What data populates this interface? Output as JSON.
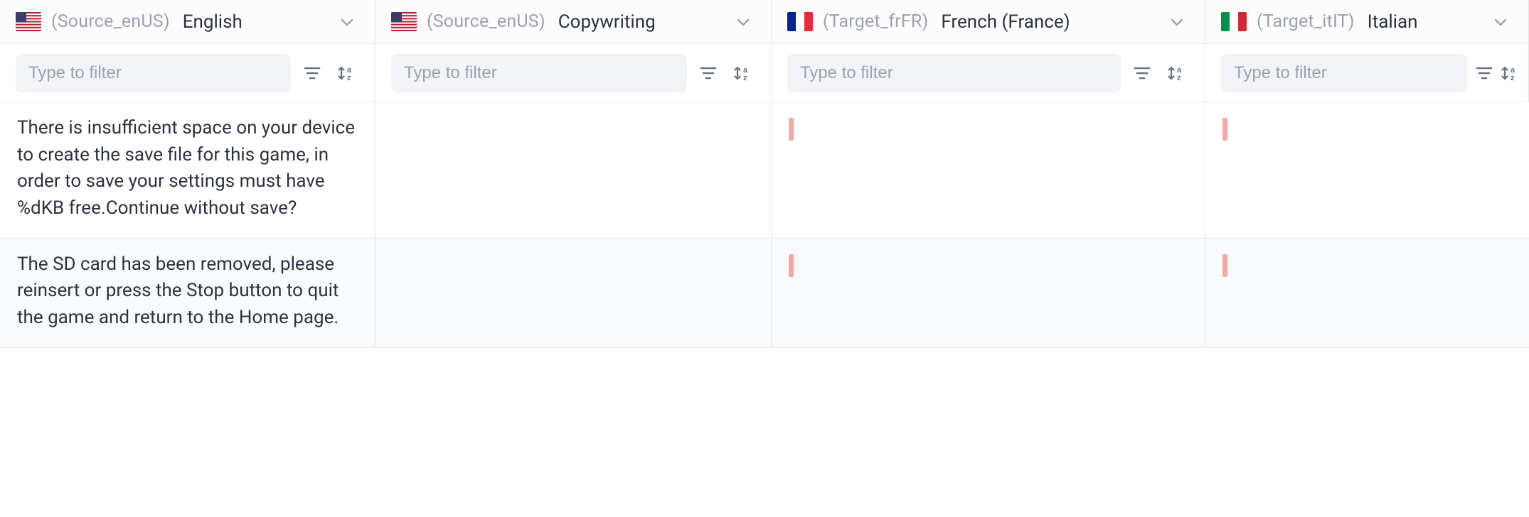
{
  "columns": [
    {
      "flag": "us",
      "locale": "(Source_enUS)",
      "name": "English"
    },
    {
      "flag": "us",
      "locale": "(Source_enUS)",
      "name": "Copywriting"
    },
    {
      "flag": "fr",
      "locale": "(Target_frFR)",
      "name": "French (France)"
    },
    {
      "flag": "it",
      "locale": "(Target_itIT)",
      "name": "Italian"
    }
  ],
  "filter": {
    "placeholder": "Type to filter"
  },
  "rows": [
    {
      "cells": [
        {
          "text": "There is insufficient space on your device to create the save file for this game, in order to save your settings must have %dKB free.Continue without save?"
        },
        {
          "text": ""
        },
        {
          "text": "",
          "empty_marker": true
        },
        {
          "text": "",
          "empty_marker": true
        }
      ]
    },
    {
      "alt": true,
      "cells": [
        {
          "text": "The SD card has been removed, please reinsert or press the Stop button to quit the game and return to the Home page."
        },
        {
          "text": ""
        },
        {
          "text": "",
          "empty_marker": true
        },
        {
          "text": "",
          "empty_marker": true
        }
      ]
    }
  ]
}
